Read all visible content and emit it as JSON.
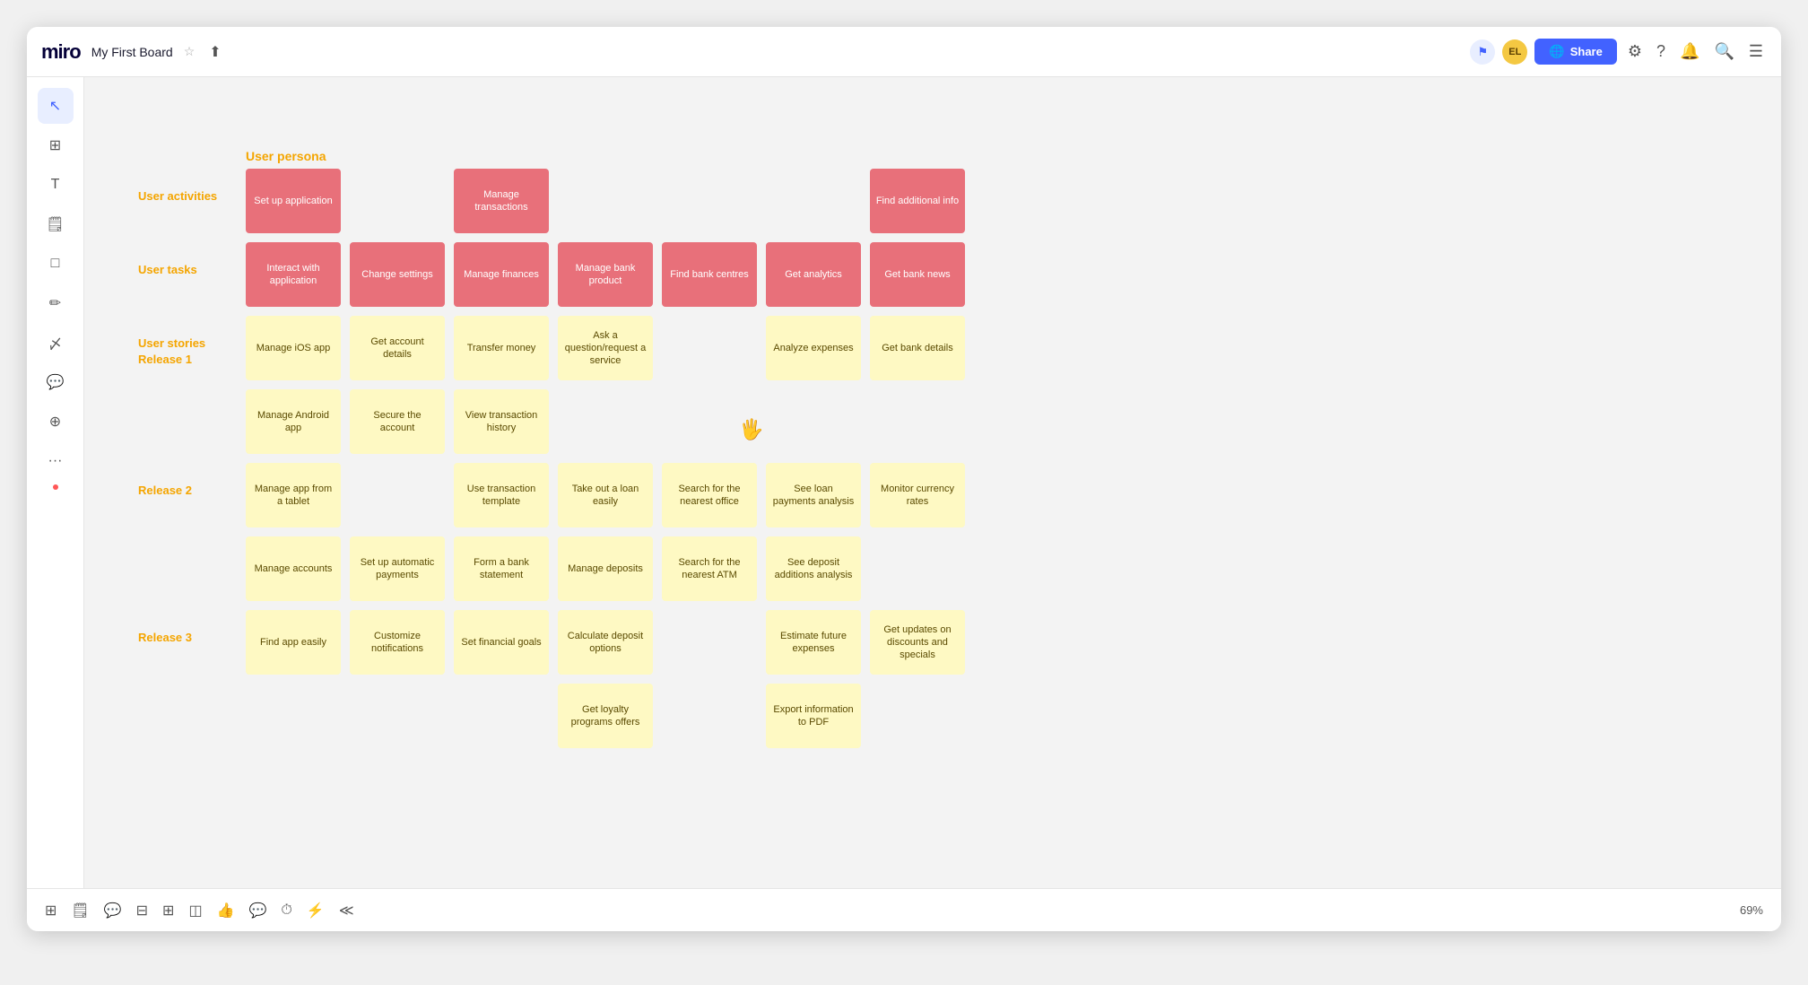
{
  "app": {
    "logo": "miro",
    "board_title": "My First Board",
    "share_label": "Share",
    "zoom": "69%"
  },
  "toolbar": {
    "tools": [
      "cursor",
      "frame",
      "text",
      "sticky",
      "rectangle",
      "pen",
      "marker",
      "comment",
      "crop",
      "more"
    ],
    "bottom_tools": [
      "frame",
      "sticky",
      "comment",
      "table",
      "grid",
      "template",
      "like",
      "chat",
      "timer",
      "lightning",
      "collapse"
    ]
  },
  "labels": {
    "user_persona": "User persona",
    "user_activities": "User activities",
    "user_tasks": "User tasks",
    "user_stories_release1": "User stories\nRelease 1",
    "release2": "Release 2",
    "release3": "Release 3"
  },
  "cards": {
    "user_activities": [
      {
        "text": "Set up application",
        "col": 0
      },
      {
        "text": "Manage transactions",
        "col": 2
      },
      {
        "text": "Find additional info",
        "col": 6
      }
    ],
    "user_tasks": [
      {
        "text": "Interact with application",
        "col": 0
      },
      {
        "text": "Change settings",
        "col": 1
      },
      {
        "text": "Manage finances",
        "col": 2
      },
      {
        "text": "Manage bank product",
        "col": 3
      },
      {
        "text": "Find bank centres",
        "col": 4
      },
      {
        "text": "Get analytics",
        "col": 5
      },
      {
        "text": "Get bank news",
        "col": 6
      }
    ],
    "release1_row1": [
      {
        "text": "Manage iOS app",
        "col": 0
      },
      {
        "text": "Get account details",
        "col": 1
      },
      {
        "text": "Transfer money",
        "col": 2
      },
      {
        "text": "Ask a question/request a service",
        "col": 3
      },
      {
        "text": "",
        "col": 4
      },
      {
        "text": "Analyze expenses",
        "col": 5
      },
      {
        "text": "Get bank details",
        "col": 6
      }
    ],
    "release1_row2": [
      {
        "text": "Manage Android app",
        "col": 0
      },
      {
        "text": "Secure the account",
        "col": 1
      },
      {
        "text": "View transaction history",
        "col": 2
      },
      {
        "text": "",
        "col": 3
      },
      {
        "text": "",
        "col": 4
      },
      {
        "text": "",
        "col": 5
      },
      {
        "text": "",
        "col": 6
      }
    ],
    "release2_row1": [
      {
        "text": "Manage app from a tablet",
        "col": 0
      },
      {
        "text": "",
        "col": 1
      },
      {
        "text": "Use transaction template",
        "col": 2
      },
      {
        "text": "Take out a loan easily",
        "col": 3
      },
      {
        "text": "Search for the nearest office",
        "col": 4
      },
      {
        "text": "See loan payments analysis",
        "col": 5
      },
      {
        "text": "Monitor currency rates",
        "col": 6
      }
    ],
    "release2_row2": [
      {
        "text": "Manage accounts",
        "col": 0
      },
      {
        "text": "Set up automatic payments",
        "col": 1
      },
      {
        "text": "Form a bank statement",
        "col": 2
      },
      {
        "text": "Manage deposits",
        "col": 3
      },
      {
        "text": "Search for the nearest ATM",
        "col": 4
      },
      {
        "text": "See deposit additions analysis",
        "col": 5
      },
      {
        "text": "",
        "col": 6
      }
    ],
    "release3_row1": [
      {
        "text": "Find app easily",
        "col": 0
      },
      {
        "text": "Customize notifications",
        "col": 1
      },
      {
        "text": "Set financial goals",
        "col": 2
      },
      {
        "text": "Calculate deposit options",
        "col": 3
      },
      {
        "text": "",
        "col": 4
      },
      {
        "text": "Estimate future expenses",
        "col": 5
      },
      {
        "text": "Get updates on discounts and specials",
        "col": 6
      }
    ],
    "release3_row2": [
      {
        "text": "",
        "col": 0
      },
      {
        "text": "",
        "col": 1
      },
      {
        "text": "",
        "col": 2
      },
      {
        "text": "Get loyalty programs offers",
        "col": 3
      },
      {
        "text": "",
        "col": 4
      },
      {
        "text": "Export information to PDF",
        "col": 5
      },
      {
        "text": "",
        "col": 6
      }
    ]
  }
}
